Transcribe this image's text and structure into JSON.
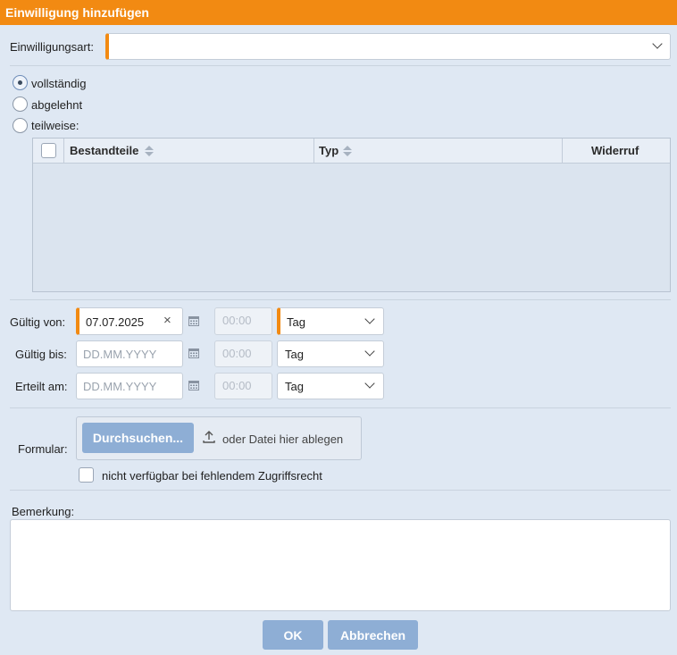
{
  "dialog": {
    "title": "Einwilligung hinzufügen"
  },
  "consent_type": {
    "label": "Einwilligungsart:",
    "value": ""
  },
  "scope": {
    "options": [
      {
        "label": "vollständig",
        "checked": true
      },
      {
        "label": "abgelehnt",
        "checked": false
      },
      {
        "label": "teilweise:",
        "checked": false
      }
    ]
  },
  "components_table": {
    "columns": [
      "Bestandteile",
      "Typ",
      "Widerruf"
    ],
    "rows": []
  },
  "valid_from": {
    "label": "Gültig von:",
    "date": "07.07.2025",
    "time_placeholder": "00:00",
    "unit": "Tag"
  },
  "valid_to": {
    "label": "Gültig bis:",
    "date_placeholder": "DD.MM.YYYY",
    "time_placeholder": "00:00",
    "unit": "Tag"
  },
  "granted_on": {
    "label": "Erteilt am:",
    "date_placeholder": "DD.MM.YYYY",
    "time_placeholder": "00:00",
    "unit": "Tag"
  },
  "form_upload": {
    "label": "Formular:",
    "browse_label": "Durchsuchen...",
    "drop_text": "oder Datei hier ablegen",
    "restricted_label": "nicht verfügbar bei fehlendem Zugriffsrecht"
  },
  "remark": {
    "label": "Bemerkung:",
    "value": ""
  },
  "buttons": {
    "ok": "OK",
    "cancel": "Abbrechen"
  },
  "colors": {
    "accent": "#f28a12",
    "button": "#8eaed5",
    "background": "#dfe8f3"
  }
}
